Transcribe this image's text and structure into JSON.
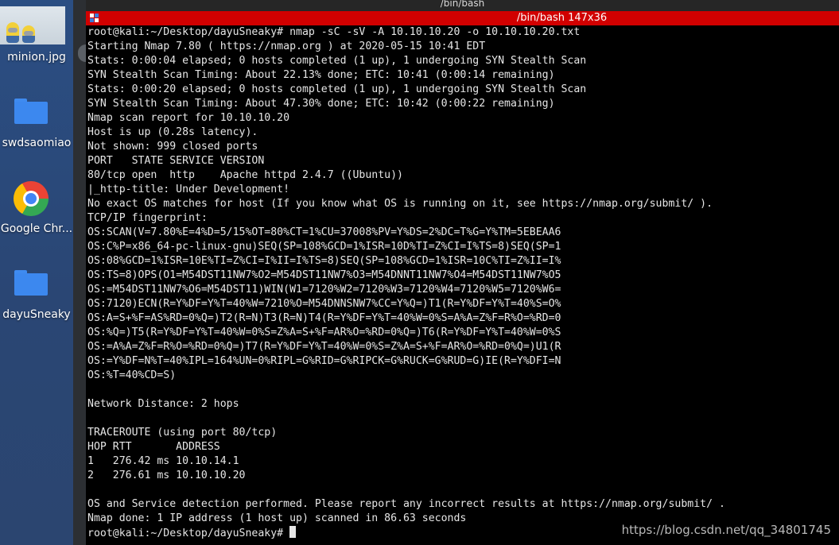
{
  "window": {
    "top_title": "/bin/bash",
    "terminal_title": "/bin/bash 147x36"
  },
  "desktop": {
    "items": [
      {
        "label": "minion.jpg",
        "icon": "image-thumbnail-icon"
      },
      {
        "label": "swdsaomiao",
        "icon": "folder-icon"
      },
      {
        "label": "Google Chr...",
        "icon": "chrome-icon"
      },
      {
        "label": "dayuSneaky",
        "icon": "folder-icon"
      }
    ]
  },
  "terminal": {
    "lines": [
      "root@kali:~/Desktop/dayuSneaky# nmap -sC -sV -A 10.10.10.20 -o 10.10.10.20.txt",
      "Starting Nmap 7.80 ( https://nmap.org ) at 2020-05-15 10:41 EDT",
      "Stats: 0:00:04 elapsed; 0 hosts completed (1 up), 1 undergoing SYN Stealth Scan",
      "SYN Stealth Scan Timing: About 22.13% done; ETC: 10:41 (0:00:14 remaining)",
      "Stats: 0:00:20 elapsed; 0 hosts completed (1 up), 1 undergoing SYN Stealth Scan",
      "SYN Stealth Scan Timing: About 47.30% done; ETC: 10:42 (0:00:22 remaining)",
      "Nmap scan report for 10.10.10.20",
      "Host is up (0.28s latency).",
      "Not shown: 999 closed ports",
      "PORT   STATE SERVICE VERSION",
      "80/tcp open  http    Apache httpd 2.4.7 ((Ubuntu))",
      "|_http-title: Under Development!",
      "No exact OS matches for host (If you know what OS is running on it, see https://nmap.org/submit/ ).",
      "TCP/IP fingerprint:",
      "OS:SCAN(V=7.80%E=4%D=5/15%OT=80%CT=1%CU=37008%PV=Y%DS=2%DC=T%G=Y%TM=5EBEAA6",
      "OS:C%P=x86_64-pc-linux-gnu)SEQ(SP=108%GCD=1%ISR=10D%TI=Z%CI=I%TS=8)SEQ(SP=1",
      "OS:08%GCD=1%ISR=10E%TI=Z%CI=I%II=I%TS=8)SEQ(SP=108%GCD=1%ISR=10C%TI=Z%II=I%",
      "OS:TS=8)OPS(O1=M54DST11NW7%O2=M54DST11NW7%O3=M54DNNT11NW7%O4=M54DST11NW7%O5",
      "OS:=M54DST11NW7%O6=M54DST11)WIN(W1=7120%W2=7120%W3=7120%W4=7120%W5=7120%W6=",
      "OS:7120)ECN(R=Y%DF=Y%T=40%W=7210%O=M54DNNSNW7%CC=Y%Q=)T1(R=Y%DF=Y%T=40%S=O%",
      "OS:A=S+%F=AS%RD=0%Q=)T2(R=N)T3(R=N)T4(R=Y%DF=Y%T=40%W=0%S=A%A=Z%F=R%O=%RD=0",
      "OS:%Q=)T5(R=Y%DF=Y%T=40%W=0%S=Z%A=S+%F=AR%O=%RD=0%Q=)T6(R=Y%DF=Y%T=40%W=0%S",
      "OS:=A%A=Z%F=R%O=%RD=0%Q=)T7(R=Y%DF=Y%T=40%W=0%S=Z%A=S+%F=AR%O=%RD=0%Q=)U1(R",
      "OS:=Y%DF=N%T=40%IPL=164%UN=0%RIPL=G%RID=G%RIPCK=G%RUCK=G%RUD=G)IE(R=Y%DFI=N",
      "OS:%T=40%CD=S)",
      "",
      "Network Distance: 2 hops",
      "",
      "TRACEROUTE (using port 80/tcp)",
      "HOP RTT       ADDRESS",
      "1   276.42 ms 10.10.14.1",
      "2   276.61 ms 10.10.10.20",
      "",
      "OS and Service detection performed. Please report any incorrect results at https://nmap.org/submit/ .",
      "Nmap done: 1 IP address (1 host up) scanned in 86.63 seconds"
    ],
    "prompt": "root@kali:~/Desktop/dayuSneaky# "
  },
  "watermark": "https://blog.csdn.net/qq_34801745",
  "colors": {
    "titlebar": "#d10000",
    "terminal_bg": "#000000",
    "terminal_fg": "#e6e6e6",
    "desktop_bg": "#2b4e83"
  }
}
